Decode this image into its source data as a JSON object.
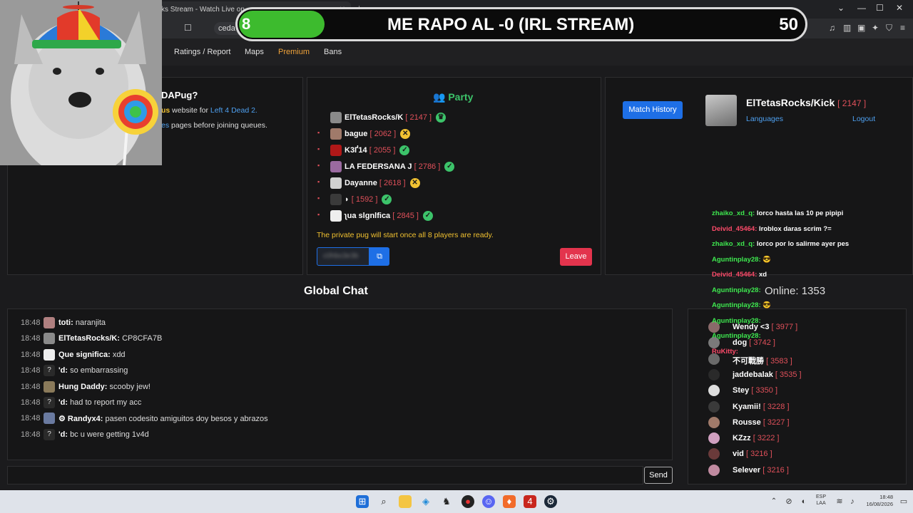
{
  "browser": {
    "tab_title": "ks Stream - Watch Live on",
    "url_text": "ceda",
    "new_tab": "+",
    "minimize": "⌄",
    "restore": "—",
    "maximize": "☐",
    "close": "✕"
  },
  "overlay": {
    "left_number": "8",
    "title": "ME RAPO AL -0 (IRL STREAM)",
    "right_number": "50"
  },
  "nav": {
    "items": [
      "Ratings / Report",
      "Maps",
      "Premium",
      "Bans"
    ]
  },
  "info_panel": {
    "heading": "DAPug?",
    "line1_prefix": "us",
    "line1_mid": " website for ",
    "line1_link": "Left 4 Dead 2.",
    "line2_prefix": "es",
    "line2_text": " pages before joining queues."
  },
  "party": {
    "title": "Party",
    "members": [
      {
        "name": "ElTetasRocks/K",
        "elo": "[ 2147 ]",
        "status": "leader",
        "status_icon": "♛",
        "avatar_color": "#8a8a8a"
      },
      {
        "name": "bague",
        "elo": "[ 2062 ]",
        "status": "waiting",
        "status_icon": "✕",
        "avatar_color": "#a07a6a"
      },
      {
        "name": "K3Ґ14",
        "elo": "[ 2055 ]",
        "status": "ready",
        "status_icon": "✓",
        "avatar_color": "#b01818"
      },
      {
        "name": "LA FEDERSANA J",
        "elo": "[ 2786 ]",
        "status": "ready",
        "status_icon": "✓",
        "avatar_color": "#9a6aa0"
      },
      {
        "name": "Dayanne",
        "elo": "[ 2618 ]",
        "status": "waiting",
        "status_icon": "✕",
        "avatar_color": "#d0d0d0"
      },
      {
        "name": "◗",
        "elo": "[ 1592 ]",
        "status": "ready",
        "status_icon": "✓",
        "avatar_color": "#3a3a3a"
      },
      {
        "name": "ʅua slgnlfica",
        "elo": "[ 2845 ]",
        "status": "ready",
        "status_icon": "✓",
        "avatar_color": "#eeeeee"
      }
    ],
    "notice": "The private pug will start once all 8 players are ready.",
    "code_value": "c0hbo3e3b",
    "copy_icon": "⧉",
    "leave_label": "Leave"
  },
  "profile": {
    "match_history_label": "Match History",
    "username": "ElTetasRocks/Kick",
    "elo": "[ 2147 ]",
    "languages_label": "Languages",
    "logout_label": "Logout"
  },
  "global_chat": {
    "title": "Global Chat",
    "send_label": "Send",
    "input_placeholder": "",
    "messages": [
      {
        "time": "18:48",
        "user": "toti:",
        "text": "naranjita",
        "q": false,
        "avatar_color": "#b08080"
      },
      {
        "time": "18:48",
        "user": "ElTetasRocks/K:",
        "text": "CP8CFA7B",
        "q": false,
        "avatar_color": "#8a8a8a"
      },
      {
        "time": "18:48",
        "user": "Que significa:",
        "text": "xdd",
        "q": false,
        "avatar_color": "#eeeeee"
      },
      {
        "time": "18:48",
        "user": "'d:",
        "text": "so embarrassing",
        "q": true,
        "avatar_color": "#2a2a2a"
      },
      {
        "time": "18:48",
        "user": "Hung Daddy:",
        "text": "scooby jew!",
        "q": false,
        "avatar_color": "#8a7a5a"
      },
      {
        "time": "18:48",
        "user": "'d:",
        "text": "had to report my acc",
        "q": true,
        "avatar_color": "#2a2a2a"
      },
      {
        "time": "18:48",
        "user": "⚙ Randyx4:",
        "text": "pasen codesito amiguitos doy besos y abrazos",
        "q": false,
        "avatar_color": "#6a7aa0"
      },
      {
        "time": "18:48",
        "user": "'d:",
        "text": "bc u were getting 1v4d",
        "q": true,
        "avatar_color": "#2a2a2a"
      }
    ]
  },
  "online": {
    "label": "Online: 1353",
    "users": [
      {
        "name": "Wendy <3",
        "elo": "[ 3977 ]",
        "avatar_color": "#8a6a6a"
      },
      {
        "name": "dog",
        "elo": "[ 3742 ]",
        "avatar_color": "#7a7a7a"
      },
      {
        "name": "不可戰勝",
        "elo": "[ 3583 ]",
        "avatar_color": "#6a6a6a"
      },
      {
        "name": "jaddebalak",
        "elo": "[ 3535 ]",
        "avatar_color": "#2a2a2a"
      },
      {
        "name": "Stey",
        "elo": "[ 3350 ]",
        "avatar_color": "#dddddd"
      },
      {
        "name": "Kyamii!",
        "elo": "[ 3228 ]",
        "avatar_color": "#3a3a3a"
      },
      {
        "name": "Rousse",
        "elo": "[ 3227 ]",
        "avatar_color": "#a07a6a"
      },
      {
        "name": "KZzz",
        "elo": "[ 3222 ]",
        "avatar_color": "#d0a0c0"
      },
      {
        "name": "vid",
        "elo": "[ 3216 ]",
        "avatar_color": "#6a3a3a"
      },
      {
        "name": "Selever",
        "elo": "[ 3216 ]",
        "avatar_color": "#c08aa0"
      }
    ]
  },
  "stream_chat": [
    {
      "user": "zhaiko_xd_q:",
      "text": "lorco hasta las 10 pe pipipi",
      "red": false
    },
    {
      "user": "Deivid_45464:",
      "text": "lroblox daras scrim ?=",
      "red": true
    },
    {
      "user": "zhaiko_xd_q:",
      "text": "lorco por lo salirme ayer pes",
      "red": false
    },
    {
      "user": "Aguntinplay28:",
      "text": "😎",
      "red": false
    },
    {
      "user": "Deivid_45464:",
      "text": "xd",
      "red": true
    },
    {
      "user": "Aguntinplay28:",
      "text": "",
      "red": false
    },
    {
      "user": "Aguntinplay28:",
      "text": "😎",
      "red": false
    },
    {
      "user": "Aguntinplay28:",
      "text": "",
      "red": false
    },
    {
      "user": "Aguntinplay28:",
      "text": "",
      "red": false
    },
    {
      "user": "RuKitty:",
      "text": "",
      "red": true
    }
  ],
  "taskbar": {
    "lang_line1": "ESP",
    "lang_line2": "LAA",
    "time": "18:48",
    "date": "16/08/2026"
  }
}
